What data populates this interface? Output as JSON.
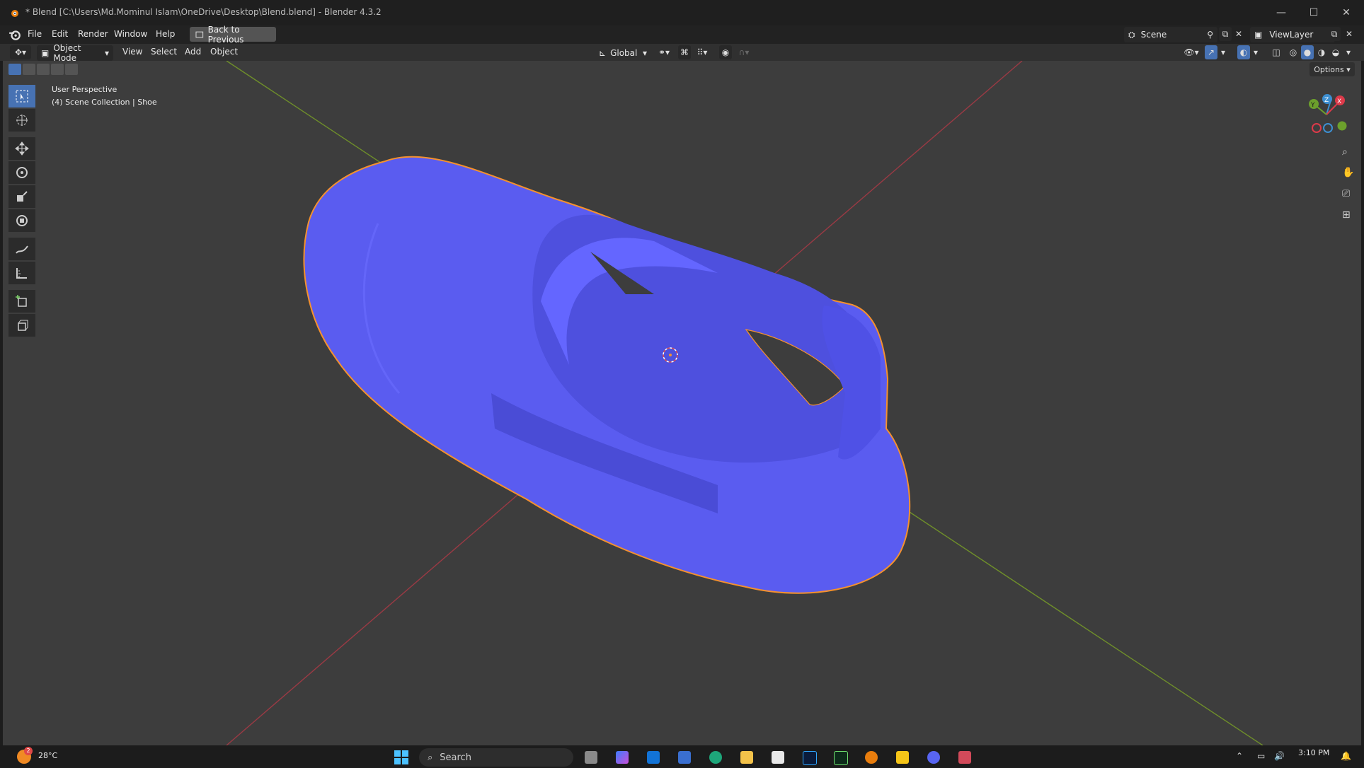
{
  "window": {
    "title": "* Blend [C:\\Users\\Md.Mominul Islam\\OneDrive\\Desktop\\Blend.blend] - Blender 4.3.2",
    "controls": {
      "minimize": "—",
      "maximize": "☐",
      "close": "✕"
    }
  },
  "menubar": {
    "items": [
      "File",
      "Edit",
      "Render",
      "Window",
      "Help"
    ],
    "back_label": "Back to Previous",
    "scene_label": "Scene",
    "viewlayer_label": "ViewLayer"
  },
  "viewport_header": {
    "mode": "Object Mode",
    "menus": [
      "View",
      "Select",
      "Add",
      "Object"
    ],
    "transform_orientation": "Global",
    "options_label": "Options"
  },
  "viewport": {
    "perspective_label": "User Perspective",
    "collection_label": "(4) Scene Collection | Shoe",
    "gizmo": {
      "x": "X",
      "y": "Y",
      "z": "Z"
    },
    "object_color": "#5a5cf0",
    "outline_color": "#f5912e",
    "background_color": "#3d3d3d"
  },
  "toolbar": {
    "tools": [
      "select-box",
      "cursor",
      "move",
      "rotate",
      "scale",
      "transform",
      "annotate",
      "measure",
      "add-cube",
      "extrude"
    ]
  },
  "taskbar": {
    "weather_temp": "28°C",
    "weather_badge": "2",
    "search_placeholder": "Search",
    "time": "3:10 PM",
    "apps": [
      "start",
      "search",
      "task-view",
      "copilot",
      "outlook",
      "store",
      "edge",
      "explorer",
      "notepad",
      "photoshop",
      "pt",
      "blender",
      "sticky",
      "discord",
      "snip"
    ]
  }
}
